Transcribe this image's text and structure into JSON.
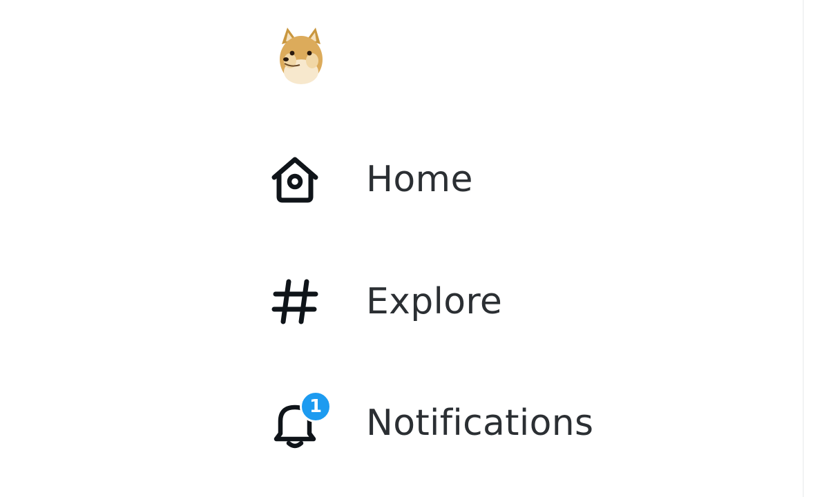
{
  "logo": {
    "icon": "doge-icon"
  },
  "nav": {
    "items": [
      {
        "label": "Home",
        "icon": "home-icon"
      },
      {
        "label": "Explore",
        "icon": "hashtag-icon"
      },
      {
        "label": "Notifications",
        "icon": "bell-icon",
        "badge": "1"
      }
    ]
  },
  "colors": {
    "badge": "#1d9bf0",
    "text": "#0f1419",
    "background": "#ffffff"
  }
}
